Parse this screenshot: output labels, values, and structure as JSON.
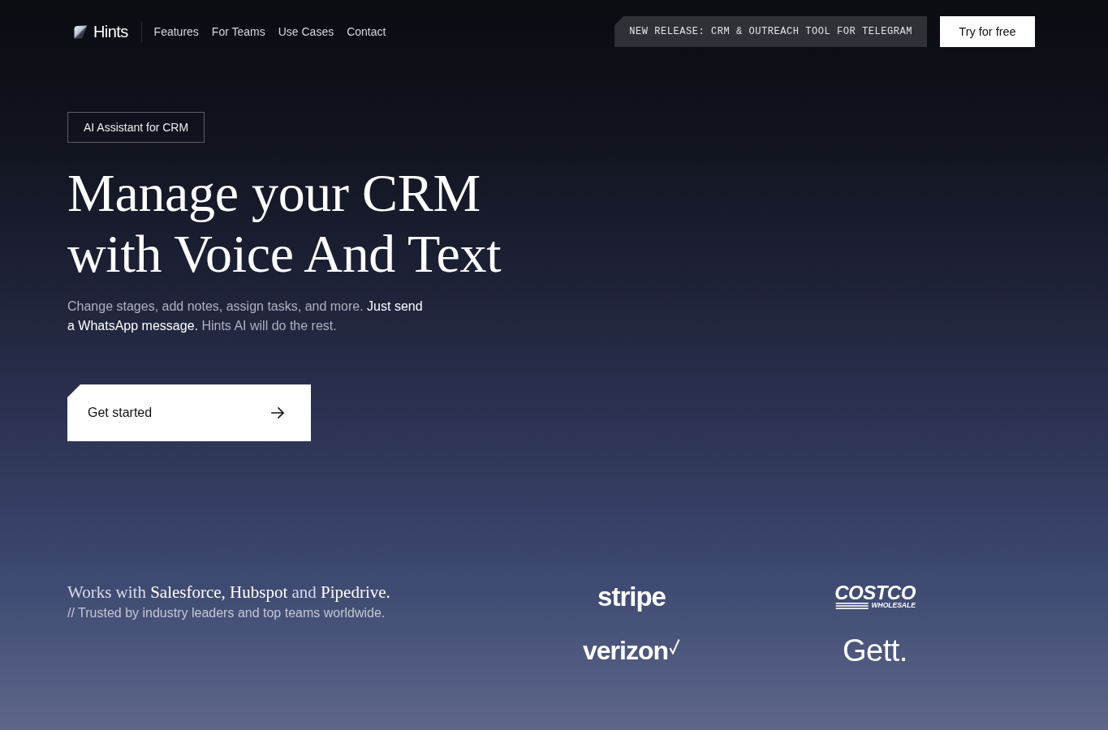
{
  "header": {
    "brand": "Hints",
    "nav_links": [
      "Features",
      "For Teams",
      "Use Cases",
      "Contact"
    ],
    "announcement": "NEW RELEASE: CRM & OUTREACH TOOL FOR TELEGRAM",
    "cta": "Try for free"
  },
  "hero": {
    "badge": "AI Assistant for CRM",
    "title": "Manage your CRM with Voice And Text",
    "subtitle": "Change stages, add notes, assign tasks, and more. **Just send a WhatsApp message.** Hints AI will do the rest.",
    "button": "Get started"
  },
  "integrations": {
    "heading": "Works with **Salesforce, Hubspot** and **Pipedrive.**",
    "note": "// Trusted by industry leaders and top teams worldwide.",
    "logos": [
      {
        "kind": "stripe",
        "text": "stripe"
      },
      {
        "kind": "costco",
        "text": "COSTCO",
        "subtext": "WHOLESALE"
      },
      {
        "kind": "verizon",
        "text": "verizon"
      },
      {
        "kind": "gett",
        "text": "Gett."
      }
    ]
  }
}
